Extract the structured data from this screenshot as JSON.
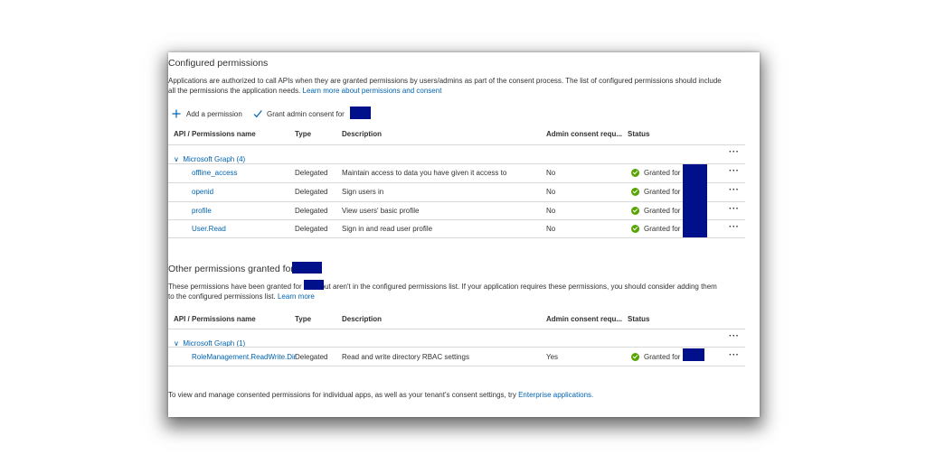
{
  "configured": {
    "title": "Configured permissions",
    "desc_line1": "Applications are authorized to call APIs when they are granted permissions by users/admins as part of the consent process. The list of configured permissions should include",
    "desc_line2": "all the permissions the application needs.",
    "learn_more": "Learn more about permissions and consent",
    "add_permission": "Add a permission",
    "grant_consent": "Grant admin consent for",
    "columns": [
      "API / Permissions name",
      "Type",
      "Description",
      "Admin consent requ...",
      "Status"
    ],
    "group": "Microsoft Graph (4)",
    "rows": [
      {
        "name": "offline_access",
        "type": "Delegated",
        "desc": "Maintain access to data you have given it access to",
        "admin": "No",
        "status": "Granted for"
      },
      {
        "name": "openid",
        "type": "Delegated",
        "desc": "Sign users in",
        "admin": "No",
        "status": "Granted for"
      },
      {
        "name": "profile",
        "type": "Delegated",
        "desc": "View users' basic profile",
        "admin": "No",
        "status": "Granted for"
      },
      {
        "name": "User.Read",
        "type": "Delegated",
        "desc": "Sign in and read user profile",
        "admin": "No",
        "status": "Granted for"
      }
    ]
  },
  "other": {
    "title": "Other permissions granted for",
    "desc_a": "These permissions have been granted for",
    "desc_b": "but aren't in the configured permissions list. If your application requires these permissions, you should consider adding them",
    "desc_line2": "to the configured permissions list.",
    "learn_more": "Learn more",
    "columns": [
      "API / Permissions name",
      "Type",
      "Description",
      "Admin consent requ...",
      "Status"
    ],
    "group": "Microsoft Graph (1)",
    "rows": [
      {
        "name": "RoleManagement.ReadWrite.Dir",
        "type": "Delegated",
        "desc": "Read and write directory RBAC settings",
        "admin": "Yes",
        "status": "Granted for"
      }
    ]
  },
  "footer": {
    "text": "To view and manage consented permissions for individual apps, as well as your tenant's consent settings, try",
    "link": "Enterprise applications."
  },
  "icons": {
    "plus": "plus-icon",
    "check": "checkmark-icon",
    "chevron": "chevron-down-icon",
    "granted": "check-circle-icon",
    "more": "more-icon"
  },
  "colors": {
    "link": "#0063b1",
    "success": "#57a300",
    "redaction": "#000f8a"
  },
  "more_glyph": "···"
}
